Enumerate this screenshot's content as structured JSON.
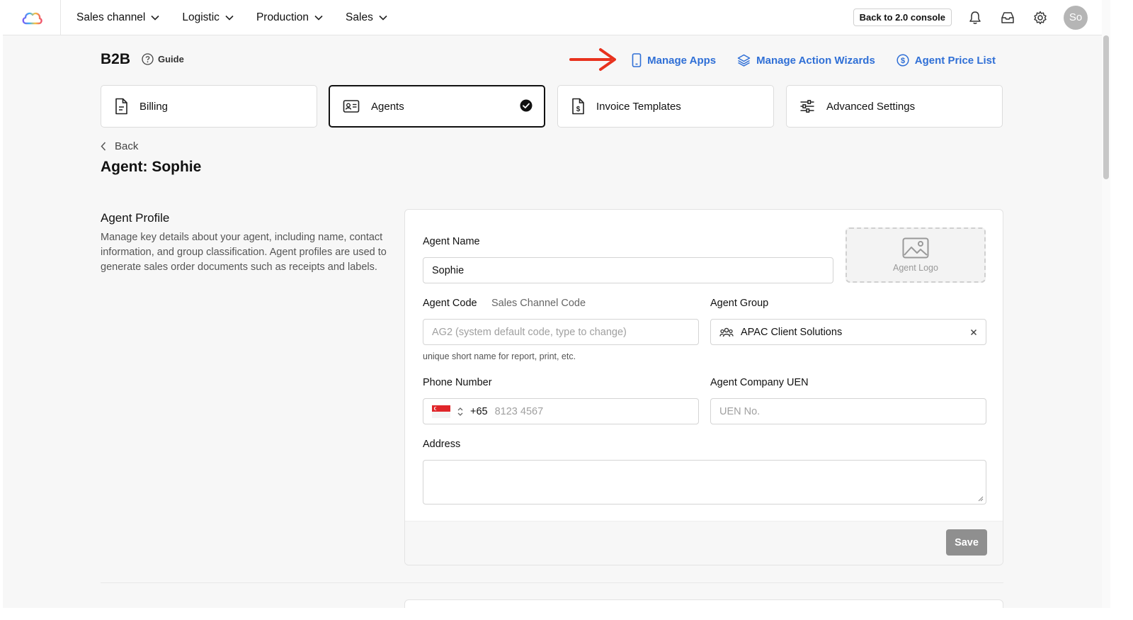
{
  "nav": {
    "items": [
      {
        "label": "Sales channel"
      },
      {
        "label": "Logistic"
      },
      {
        "label": "Production"
      },
      {
        "label": "Sales"
      }
    ],
    "console_button": "Back to 2.0 console",
    "avatar_initials": "So"
  },
  "header": {
    "title": "B2B",
    "guide_label": "Guide",
    "links": [
      {
        "label": "Manage Apps",
        "icon": "phone-icon"
      },
      {
        "label": "Manage Action Wizards",
        "icon": "layers-icon"
      },
      {
        "label": "Agent Price List",
        "icon": "dollar-circle-icon"
      }
    ],
    "accent_color": "#2f6fd6",
    "arrow_color": "#e8321e"
  },
  "tabs": [
    {
      "label": "Billing",
      "icon": "document-icon",
      "active": false
    },
    {
      "label": "Agents",
      "icon": "id-card-icon",
      "active": true
    },
    {
      "label": "Invoice Templates",
      "icon": "invoice-dollar-icon",
      "active": false
    },
    {
      "label": "Advanced Settings",
      "icon": "sliders-icon",
      "active": false
    }
  ],
  "back_label": "Back",
  "page_title": "Agent: Sophie",
  "profile": {
    "title": "Agent Profile",
    "description": "Manage key details about your agent, including name, contact information, and group classification. Agent profiles are used to generate sales order documents such as receipts and labels.",
    "agent_name_label": "Agent Name",
    "agent_name_value": "Sophie",
    "agent_logo_label": "Agent Logo",
    "agent_code_label": "Agent Code",
    "sales_channel_code_label": "Sales Channel Code",
    "agent_code_placeholder": "AG2 (system default code, type to change)",
    "agent_code_hint": "unique short name for report, print, etc.",
    "agent_group_label": "Agent Group",
    "agent_group_value": "APAC Client Solutions",
    "phone_label": "Phone Number",
    "phone_country_code": "+65",
    "phone_placeholder": "8123 4567",
    "uen_label": "Agent Company UEN",
    "uen_placeholder": "UEN No.",
    "address_label": "Address",
    "address_value": "",
    "save_label": "Save"
  }
}
